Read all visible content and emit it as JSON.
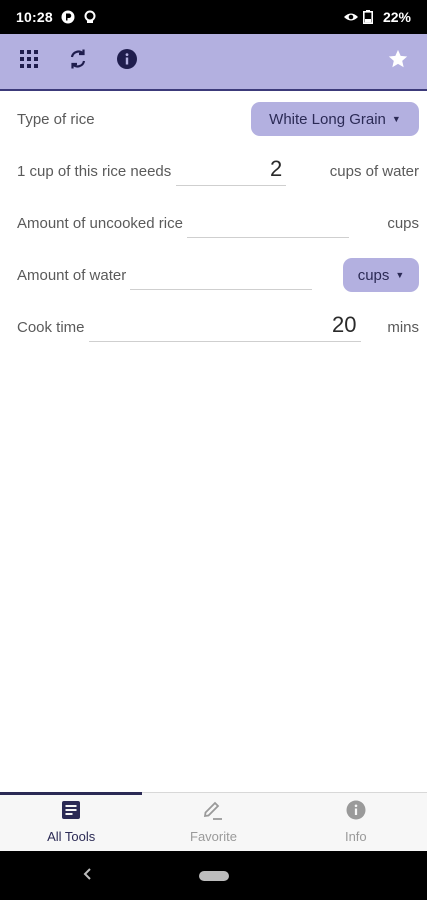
{
  "status_bar": {
    "time": "10:28",
    "battery": "22%",
    "icons": [
      "p-badge-icon",
      "notification-icon",
      "eye-icon",
      "battery-icon"
    ]
  },
  "toolbar": {
    "background": "#b3b0e0",
    "icons": [
      "grid-menu-icon",
      "refresh-icon",
      "info-icon",
      "star-icon"
    ]
  },
  "form": {
    "rice_type": {
      "label": "Type of rice",
      "selected": "White Long Grain"
    },
    "ratio": {
      "label": "1 cup of this rice needs",
      "value": "2",
      "unit": "cups of water"
    },
    "uncooked_rice": {
      "label": "Amount of uncooked rice",
      "value": "",
      "unit": "cups"
    },
    "water": {
      "label": "Amount of water",
      "value": "",
      "unit_selected": "cups"
    },
    "cook_time": {
      "label": "Cook time",
      "value": "20",
      "unit": "mins"
    }
  },
  "bottom_nav": {
    "items": [
      {
        "label": "All Tools",
        "icon": "list-doc-icon",
        "active": true
      },
      {
        "label": "Favorite",
        "icon": "pencil-icon",
        "active": false
      },
      {
        "label": "Info",
        "icon": "info-icon",
        "active": false
      }
    ]
  },
  "colors": {
    "accent": "#b3b0e0",
    "accent_dark": "#2b2a55"
  }
}
